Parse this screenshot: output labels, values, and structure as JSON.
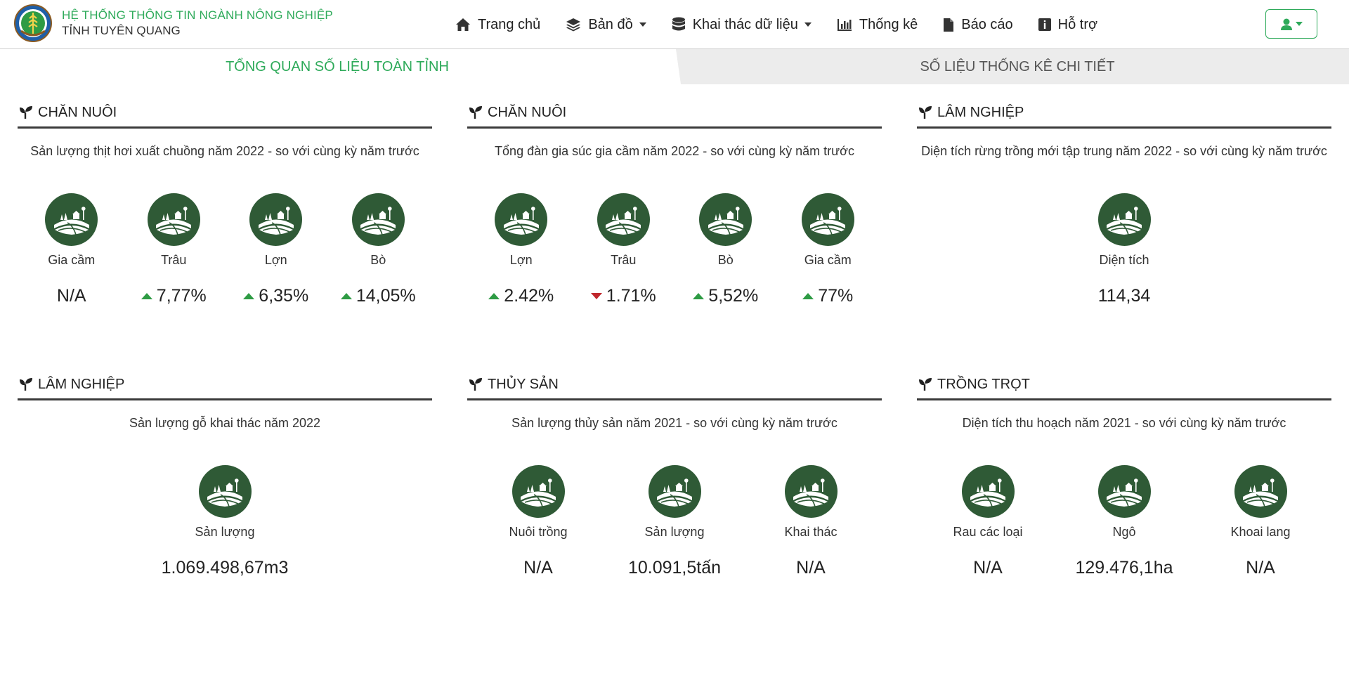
{
  "header": {
    "title": "HỆ THỐNG THÔNG TIN NGÀNH NÔNG NGHIỆP",
    "subtitle": "TỈNH TUYÊN QUANG",
    "logo_icon": "agriculture-logo-icon"
  },
  "nav": [
    {
      "label": "Trang chủ",
      "icon": "home-icon",
      "dropdown": false
    },
    {
      "label": "Bản đồ",
      "icon": "layers-icon",
      "dropdown": true
    },
    {
      "label": "Khai thác dữ liệu",
      "icon": "database-icon",
      "dropdown": true
    },
    {
      "label": "Thống kê",
      "icon": "bar-chart-icon",
      "dropdown": false
    },
    {
      "label": "Báo cáo",
      "icon": "file-icon",
      "dropdown": false
    },
    {
      "label": "Hỗ trợ",
      "icon": "info-icon",
      "dropdown": false
    }
  ],
  "user_menu": {
    "icon": "user-icon",
    "dropdown": true
  },
  "tabs": {
    "active": "TỔNG QUAN SỐ LIỆU TOÀN TỈNH",
    "inactive": "SỐ LIỆU THỐNG KÊ CHI TIẾT"
  },
  "colors": {
    "accent": "#2eaa5a",
    "circle": "#2f5a36",
    "up": "#2e9b44",
    "down": "#c0272d"
  },
  "panels": [
    {
      "title": "CHĂN NUÔI",
      "subtitle": "Sản lượng thịt hơi xuất chuồng năm 2022 - so với cùng kỳ năm trước",
      "items": [
        {
          "label": "Gia cầm",
          "value": "N/A",
          "trend": "none"
        },
        {
          "label": "Trâu",
          "value": "7,77%",
          "trend": "up"
        },
        {
          "label": "Lợn",
          "value": "6,35%",
          "trend": "up"
        },
        {
          "label": "Bò",
          "value": "14,05%",
          "trend": "up"
        }
      ]
    },
    {
      "title": "CHĂN NUÔI",
      "subtitle": "Tổng đàn gia súc gia cầm năm 2022 - so với cùng kỳ năm trước",
      "items": [
        {
          "label": "Lợn",
          "value": "2.42%",
          "trend": "up"
        },
        {
          "label": "Trâu",
          "value": "1.71%",
          "trend": "down"
        },
        {
          "label": "Bò",
          "value": "5,52%",
          "trend": "up"
        },
        {
          "label": "Gia cầm",
          "value": "77%",
          "trend": "up"
        }
      ]
    },
    {
      "title": "LÂM NGHIỆP",
      "subtitle": "Diện tích rừng trồng mới tập trung năm 2022 - so với cùng kỳ năm trước",
      "items": [
        {
          "label": "Diện tích",
          "value": "114,34",
          "trend": "none"
        }
      ]
    },
    {
      "title": "LÂM NGHIỆP",
      "subtitle": "Sản lượng gỗ khai thác năm 2022",
      "items": [
        {
          "label": "Sản lượng",
          "value": "1.069.498,67m3",
          "trend": "none"
        }
      ]
    },
    {
      "title": "THỦY SẢN",
      "subtitle": "Sản lượng thủy sản năm 2021 - so với cùng kỳ năm trước",
      "items": [
        {
          "label": "Nuôi trồng",
          "value": "N/A",
          "trend": "none"
        },
        {
          "label": "Sản lượng",
          "value": "10.091,5tấn",
          "trend": "none"
        },
        {
          "label": "Khai thác",
          "value": "N/A",
          "trend": "none"
        }
      ]
    },
    {
      "title": "TRỒNG TRỌT",
      "subtitle": "Diện tích thu hoạch năm 2021 - so với cùng kỳ năm trước",
      "items": [
        {
          "label": "Rau các loại",
          "value": "N/A",
          "trend": "none"
        },
        {
          "label": "Ngô",
          "value": "129.476,1ha",
          "trend": "none"
        },
        {
          "label": "Khoai lang",
          "value": "N/A",
          "trend": "none"
        }
      ]
    }
  ]
}
